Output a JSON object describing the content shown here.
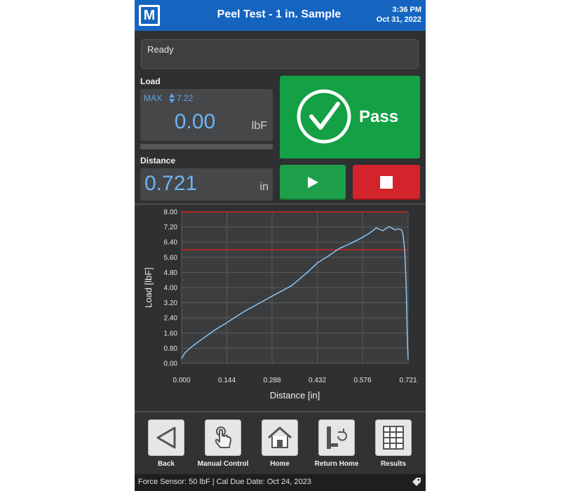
{
  "header": {
    "logo": "M",
    "title": "Peel Test - 1 in. Sample",
    "time": "3:36 PM",
    "date": "Oct 31, 2022"
  },
  "status": {
    "text": "Ready"
  },
  "load": {
    "label": "Load",
    "max_label": "MAX",
    "max_value": "7.22",
    "value": "0.00",
    "unit": "lbF"
  },
  "distance": {
    "label": "Distance",
    "value": "0.721",
    "unit": "in"
  },
  "result": {
    "label": "Pass",
    "color": "#14a045",
    "icon": "check-circle-icon"
  },
  "controls": {
    "start_icon": "play-icon",
    "stop_icon": "stop-icon"
  },
  "chart_data": {
    "type": "line",
    "xlabel": "Distance [in]",
    "ylabel": "Load [lbF]",
    "xlim": [
      0,
      0.721
    ],
    "ylim": [
      0,
      8
    ],
    "x_ticks": [
      "0.000",
      "0.144",
      "0.288",
      "0.432",
      "0.576",
      "0.721"
    ],
    "y_ticks": [
      "0.00",
      "0.80",
      "1.60",
      "2.40",
      "3.20",
      "4.00",
      "4.80",
      "5.60",
      "6.40",
      "7.20",
      "8.00"
    ],
    "grid": true,
    "limit_lines": [
      8.0,
      6.0
    ],
    "limit_color": "#d0231f",
    "series_color": "#8fc5ef",
    "series": [
      {
        "x": [
          0,
          0.01,
          0.03,
          0.05,
          0.08,
          0.1,
          0.144,
          0.2,
          0.25,
          0.288,
          0.35,
          0.4,
          0.432,
          0.47,
          0.5,
          0.54,
          0.576,
          0.6,
          0.62,
          0.64,
          0.66,
          0.68,
          0.69,
          0.7,
          0.705,
          0.71,
          0.715,
          0.718,
          0.721
        ],
        "y": [
          0.25,
          0.55,
          0.85,
          1.1,
          1.45,
          1.7,
          2.15,
          2.75,
          3.2,
          3.55,
          4.1,
          4.8,
          5.3,
          5.7,
          6.05,
          6.35,
          6.65,
          6.9,
          7.15,
          7.0,
          7.22,
          7.05,
          7.1,
          7.05,
          6.8,
          6.0,
          4.0,
          1.5,
          0.2
        ]
      }
    ]
  },
  "nav": [
    {
      "label": "Back",
      "icon": "back-triangle-icon"
    },
    {
      "label": "Manual Control",
      "icon": "hand-pointer-icon"
    },
    {
      "label": "Home",
      "icon": "home-icon"
    },
    {
      "label": "Return Home",
      "icon": "return-home-icon"
    },
    {
      "label": "Results",
      "icon": "results-grid-icon"
    }
  ],
  "footer": {
    "text": "Force Sensor: 50 lbF   |   Cal Due Date: Oct 24, 2023",
    "icon": "tag-icon"
  }
}
